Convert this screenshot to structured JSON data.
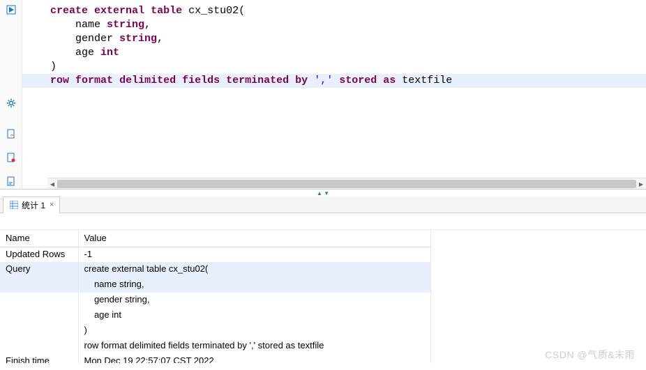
{
  "editor": {
    "code_tokens": [
      [
        {
          "t": "create",
          "c": "kw"
        },
        {
          "t": " ",
          "c": ""
        },
        {
          "t": "external",
          "c": "kw"
        },
        {
          "t": " ",
          "c": ""
        },
        {
          "t": "table",
          "c": "kw"
        },
        {
          "t": " ",
          "c": ""
        },
        {
          "t": "cx_stu02(",
          "c": "ident"
        }
      ],
      [
        {
          "t": "    name ",
          "c": "ident"
        },
        {
          "t": "string",
          "c": "type"
        },
        {
          "t": ",",
          "c": "ident"
        }
      ],
      [
        {
          "t": "    gender ",
          "c": "ident"
        },
        {
          "t": "string",
          "c": "type"
        },
        {
          "t": ",",
          "c": "ident"
        }
      ],
      [
        {
          "t": "    age ",
          "c": "ident"
        },
        {
          "t": "int",
          "c": "type"
        }
      ],
      [
        {
          "t": ")",
          "c": "ident"
        }
      ],
      [
        {
          "t": "row",
          "c": "kw"
        },
        {
          "t": " ",
          "c": ""
        },
        {
          "t": "format",
          "c": "kw"
        },
        {
          "t": " ",
          "c": ""
        },
        {
          "t": "delimited",
          "c": "kw"
        },
        {
          "t": " ",
          "c": ""
        },
        {
          "t": "fields",
          "c": "kw"
        },
        {
          "t": " ",
          "c": ""
        },
        {
          "t": "terminated",
          "c": "kw"
        },
        {
          "t": " ",
          "c": ""
        },
        {
          "t": "by",
          "c": "kw"
        },
        {
          "t": " ",
          "c": ""
        },
        {
          "t": "','",
          "c": "str"
        },
        {
          "t": " ",
          "c": ""
        },
        {
          "t": "stored",
          "c": "kw"
        },
        {
          "t": " ",
          "c": ""
        },
        {
          "t": "as",
          "c": "kw"
        },
        {
          "t": " ",
          "c": ""
        },
        {
          "t": "textfile",
          "c": "ident"
        }
      ]
    ],
    "highlight_line": 5
  },
  "tab": {
    "label": "统计 1",
    "close": "×"
  },
  "results": {
    "header_name": "Name",
    "header_value": "Value",
    "rows": [
      {
        "name": "Updated Rows",
        "value": "-1"
      },
      {
        "name": "Query",
        "value": "create external table cx_stu02(",
        "hl": true
      },
      {
        "name": "",
        "value": "    name string,",
        "hl": true
      },
      {
        "name": "",
        "value": "    gender string,"
      },
      {
        "name": "",
        "value": "    age int"
      },
      {
        "name": "",
        "value": ")"
      },
      {
        "name": "",
        "value": "row format delimited fields terminated by ',' stored as textfile"
      },
      {
        "name": "Finish time",
        "value": "Mon Dec 19 22:57:07 CST 2022"
      }
    ]
  },
  "watermark": "CSDN @气质&末雨"
}
